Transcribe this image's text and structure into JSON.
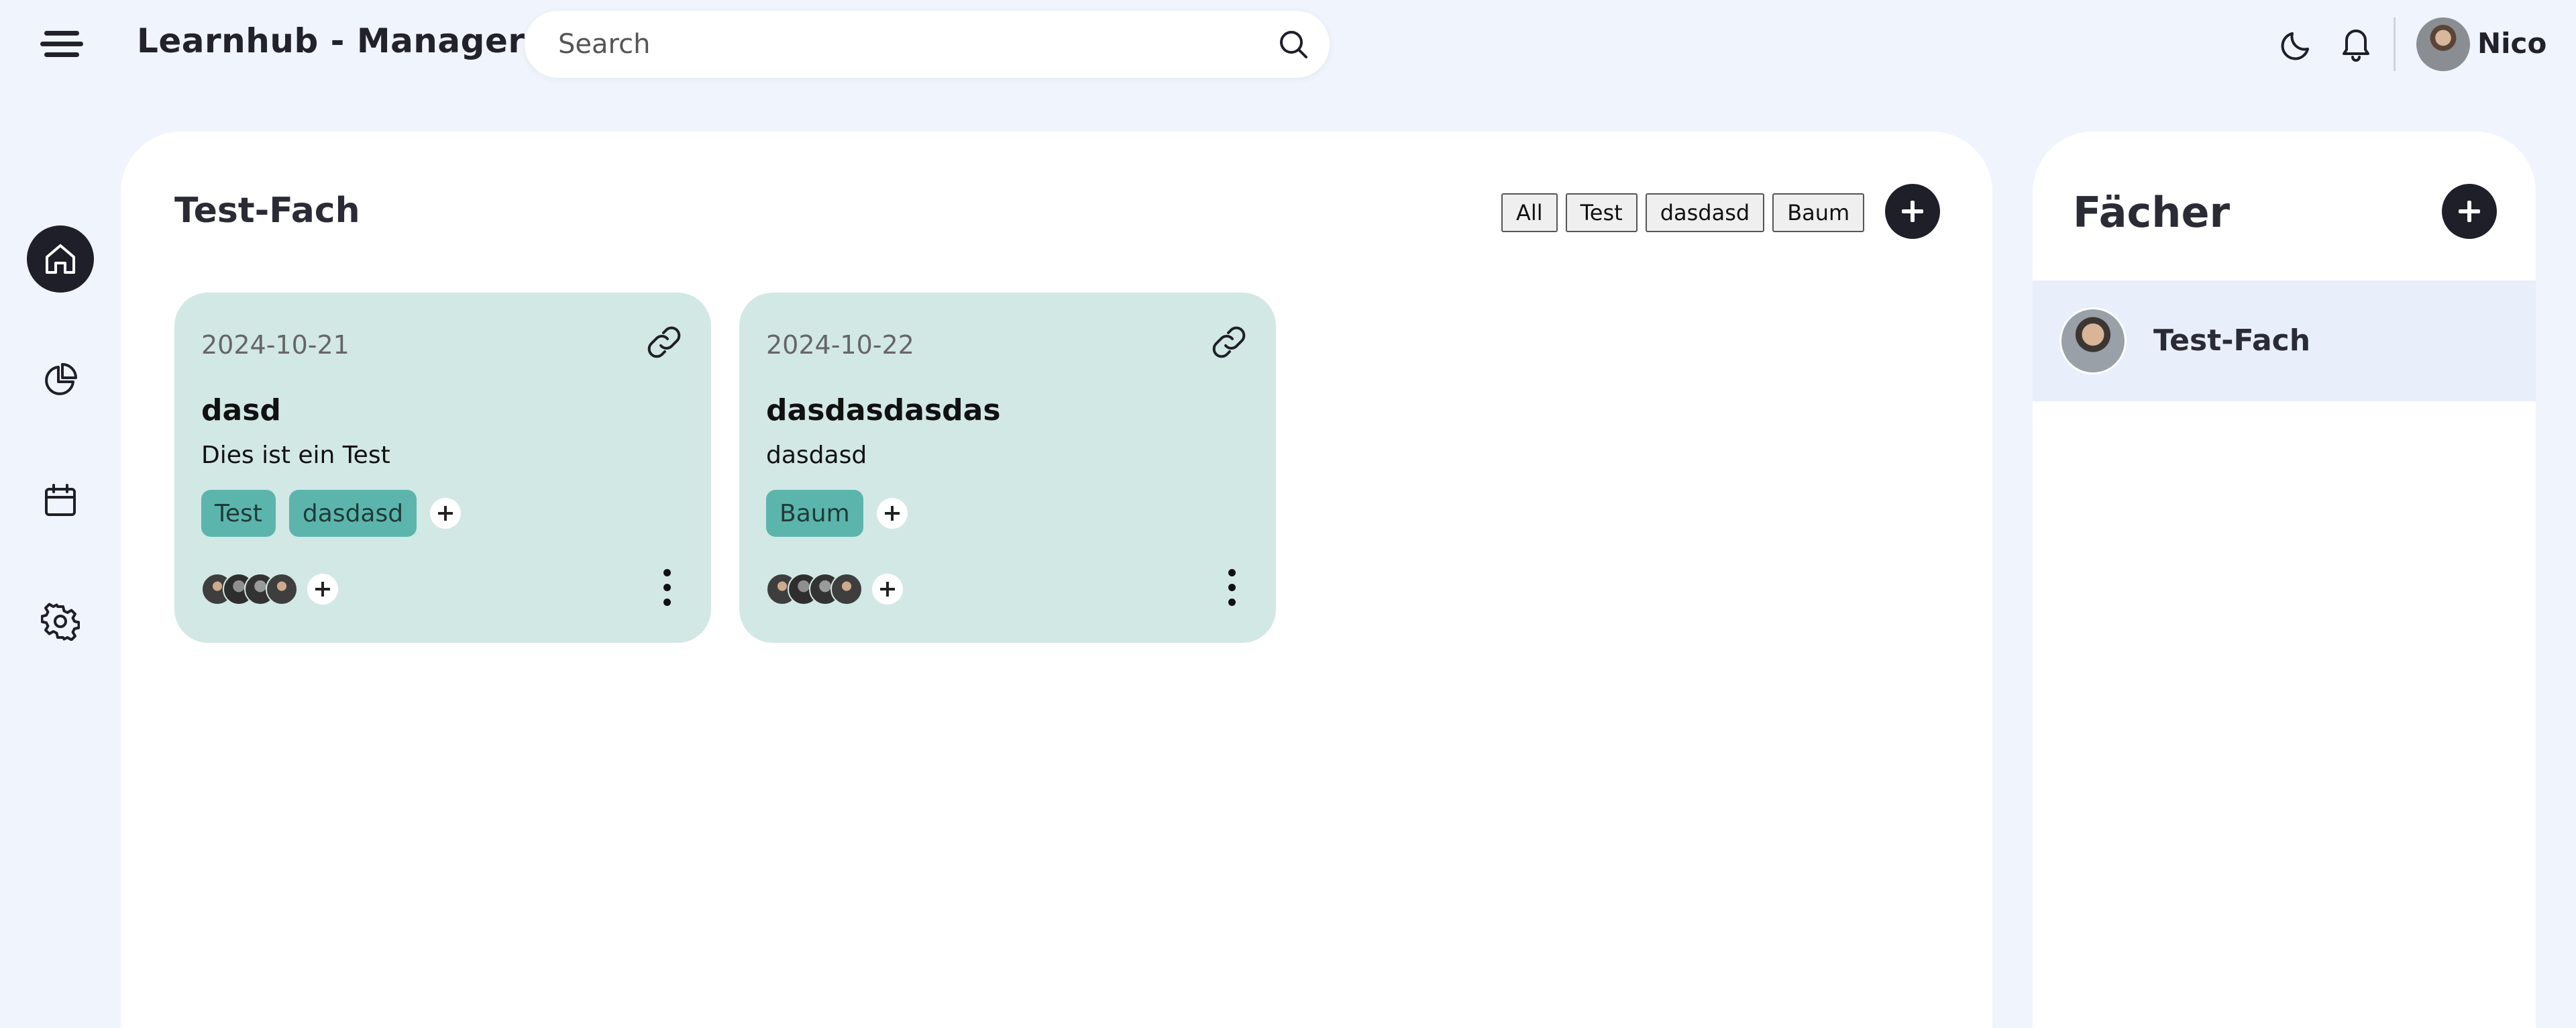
{
  "header": {
    "app_title": "Learnhub - Manager",
    "search_placeholder": "Search",
    "user_name": "Nico"
  },
  "sidebar": {
    "items": [
      {
        "name": "home",
        "icon": "home-icon",
        "active": true
      },
      {
        "name": "statistics",
        "icon": "pie-chart-icon",
        "active": false
      },
      {
        "name": "calendar",
        "icon": "calendar-icon",
        "active": false
      },
      {
        "name": "settings",
        "icon": "gear-icon",
        "active": false
      }
    ]
  },
  "main": {
    "title": "Test-Fach",
    "filters": [
      "All",
      "Test",
      "dasdasd",
      "Baum"
    ],
    "cards": [
      {
        "date": "2024-10-21",
        "title": "dasd",
        "description": "Dies ist ein Test",
        "tags": [
          "Test",
          "dasdasd"
        ],
        "member_count": 4
      },
      {
        "date": "2024-10-22",
        "title": "dasdasdasdas",
        "description": "dasdasd",
        "tags": [
          "Baum"
        ],
        "member_count": 4
      }
    ]
  },
  "subjects": {
    "title": "Fächer",
    "items": [
      {
        "label": "Test-Fach",
        "selected": true
      }
    ]
  },
  "colors": {
    "background": "#f0f4fc",
    "dark": "#1f1f29",
    "card": "#d2e8e4",
    "tag": "#5cb5ad",
    "selected_row": "#e8effb"
  }
}
